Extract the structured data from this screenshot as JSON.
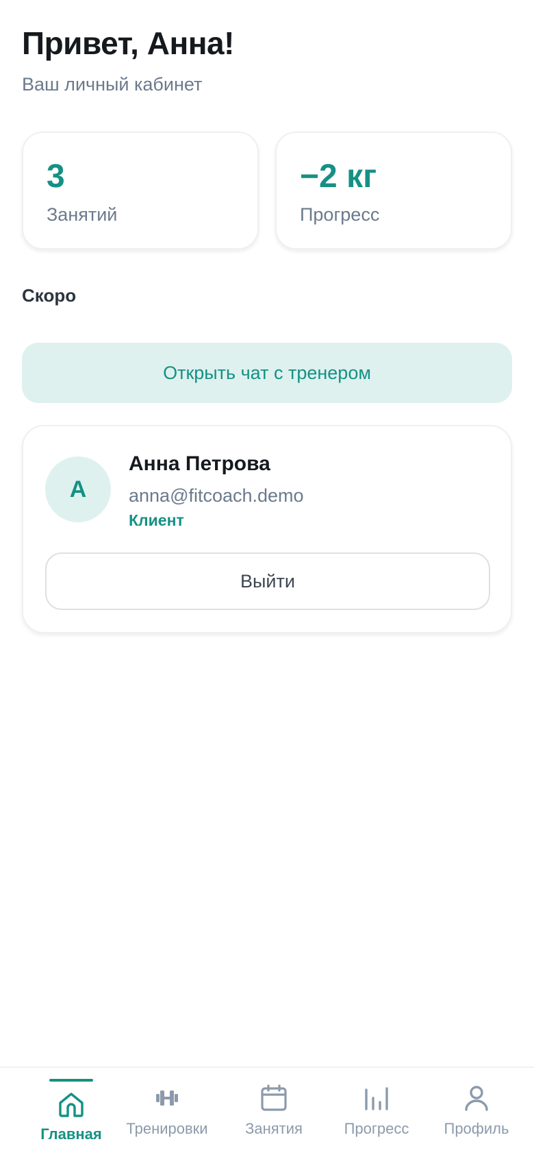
{
  "header": {
    "greeting": "Привет, Анна!",
    "subtitle": "Ваш личный кабинет"
  },
  "stats": [
    {
      "value": "3",
      "label": "Занятий"
    },
    {
      "value": "−2 кг",
      "label": "Прогресс"
    }
  ],
  "upcoming": {
    "title": "Скоро"
  },
  "chat_button": {
    "label": "Открыть чат с тренером"
  },
  "profile": {
    "avatar_initial": "А",
    "name": "Анна Петрова",
    "email": "anna@fitcoach.demo",
    "role": "Клиент",
    "logout_label": "Выйти"
  },
  "tabbar": {
    "active": "home",
    "items": [
      {
        "id": "home",
        "label": "Главная",
        "icon": "home-icon"
      },
      {
        "id": "workouts",
        "label": "Тренировки",
        "icon": "dumbbell-icon"
      },
      {
        "id": "sessions",
        "label": "Занятия",
        "icon": "calendar-icon"
      },
      {
        "id": "progress",
        "label": "Прогресс",
        "icon": "bar-chart-icon"
      },
      {
        "id": "profile",
        "label": "Профиль",
        "icon": "user-icon"
      }
    ]
  },
  "colors": {
    "accent": "#149184",
    "accent_light": "#def1ef",
    "muted_text": "#6b7a8c",
    "inactive_tab": "#8c9aab"
  }
}
